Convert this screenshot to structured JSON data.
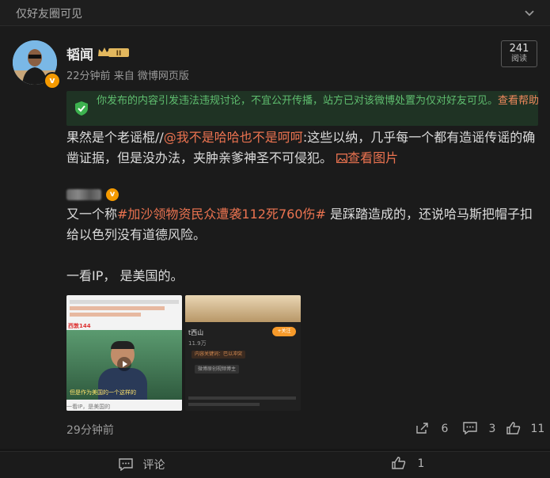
{
  "visibility": {
    "label": "仅好友圈可见"
  },
  "post": {
    "username": "韬闻",
    "rank_label": "II",
    "time": "22分钟前",
    "source": "来自 微博网页版",
    "reads_count": "241",
    "reads_label": "阅读",
    "notice_text": "你发布的内容引发违法违规讨论，不宜公开传播，站方已对该微博处置为仅对好友可见。",
    "notice_link": "查看帮助",
    "text_prefix": "果然是个老谣棍//",
    "mention": "@我不是哈哈也不是呵呵",
    "text_suffix": ":这些以纳，几乎每一个都有造谣传谣的确凿证据，但是没办法，夹肿亲爹神圣不可侵犯。",
    "view_image": "查看图片"
  },
  "repost": {
    "text_1": "又一个称",
    "hashtag": "#加沙领物资民众遭袭112死760伤#",
    "text_2": " 是踩踏造成的，还说哈马斯把帽子扣给以色列没有道德风险。",
    "text_3": "一看IP， 是美国的。",
    "time": "29分钟前",
    "shares": "6",
    "comments": "3",
    "likes": "11"
  },
  "thumb1": {
    "title": "一看IP，是美国的",
    "caption": "但是作为美国的一个这样的",
    "tag": "西敦144"
  },
  "thumb2": {
    "name": "t西山",
    "fans": "11.9万",
    "follow": "+关注",
    "chip1": "内容关键词：巴以冲突",
    "chip2": "微博原创视频博主"
  },
  "bottom": {
    "comment": "评论",
    "likes": "1"
  },
  "colors": {
    "accent": "#eb7350",
    "notice_green": "#5fbe6f",
    "vip_orange": "#f59a00"
  }
}
